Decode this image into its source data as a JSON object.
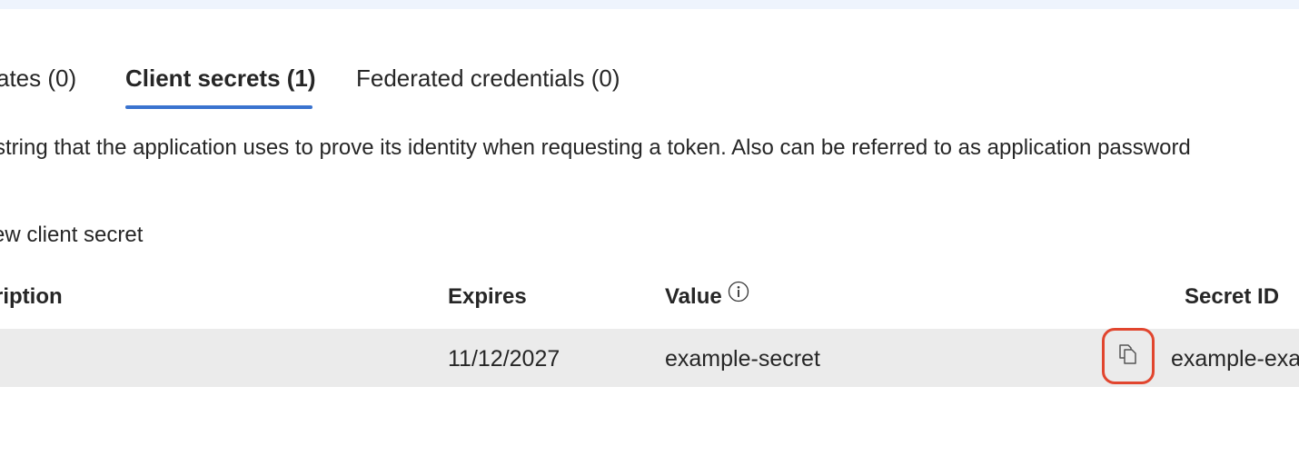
{
  "tabs": [
    {
      "label": "ates (0)"
    },
    {
      "label": "Client secrets (1)",
      "active": true
    },
    {
      "label": "Federated credentials (0)"
    }
  ],
  "description": "string that the application uses to prove its identity when requesting a token. Also can be referred to as application password",
  "new_secret_label": "ew client secret",
  "table": {
    "headers": {
      "description": "ription",
      "expires": "Expires",
      "value": "Value",
      "secret_id": "Secret ID"
    },
    "rows": [
      {
        "description": "",
        "expires": "11/12/2027",
        "value": "example-secret",
        "secret_id": "example-exa"
      }
    ]
  },
  "icons": {
    "value_info": "info-icon",
    "copy": "copy-icon"
  },
  "colors": {
    "accent": "#3a73cf",
    "highlight": "#e1452e",
    "row_bg": "#ebebeb",
    "top_bar": "#eef4fd"
  }
}
